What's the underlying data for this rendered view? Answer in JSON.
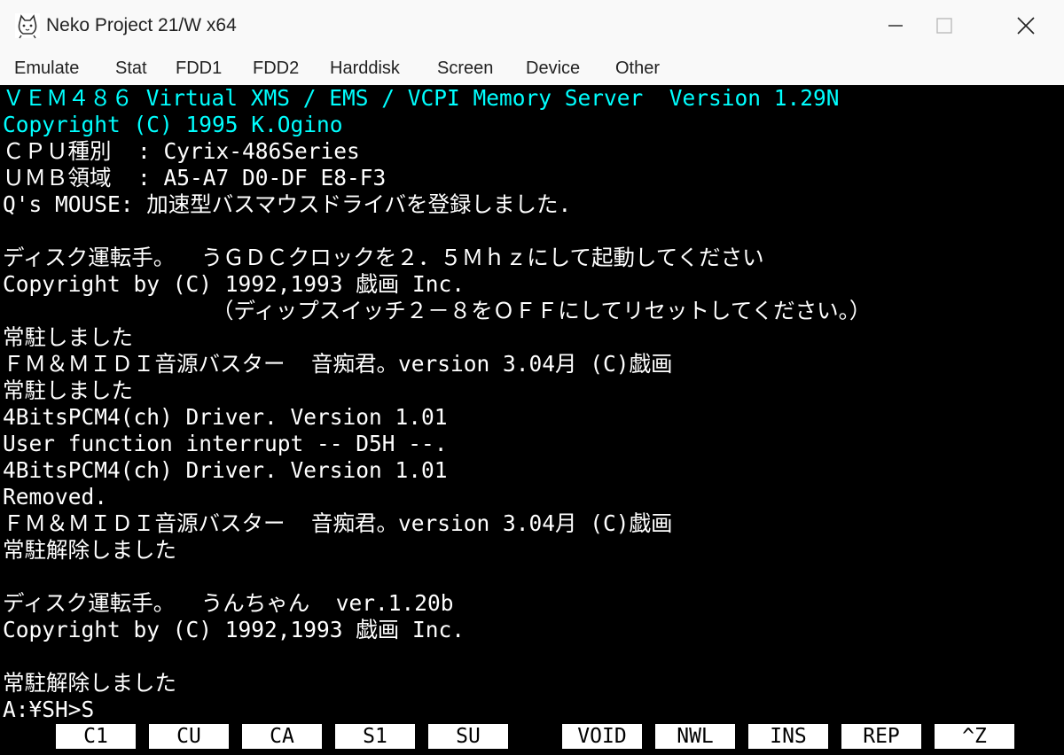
{
  "window": {
    "title": "Neko Project 21/W x64",
    "app_icon": "cat-icon",
    "minimize_icon": "minimize-icon",
    "maximize_icon": "maximize-icon",
    "close_icon": "close-icon"
  },
  "menu": [
    "Emulate",
    "Stat",
    "FDD1",
    "FDD2",
    "Harddisk",
    "Screen",
    "Device",
    "Other"
  ],
  "colors": {
    "cyan": "#00ffff",
    "white": "#ffffff",
    "background": "#000000",
    "fkey_bg": "#ffffff"
  },
  "screen_lines": [
    {
      "text": "ＶＥＭ４８６ Virtual XMS / EMS / VCPI Memory Server  Version 1.29N",
      "color": "cyan"
    },
    {
      "text": "Copyright (C) 1995 K.Ogino",
      "color": "cyan"
    },
    {
      "text": "ＣＰＵ種別  : Cyrix-486Series",
      "color": "white"
    },
    {
      "text": "ＵＭＢ領域  : A5-A7 D0-DF E8-F3",
      "color": "white"
    },
    {
      "text": "Q's MOUSE: 加速型バスマウスドライバを登録しました.",
      "color": "white"
    },
    {
      "text": "",
      "color": "white"
    },
    {
      "text": "ディスク運転手。  うＧＤＣクロックを２．５Ｍｈｚにして起動してください",
      "color": "white"
    },
    {
      "text": "Copyright by (C) 1992,1993 戯画 Inc.",
      "color": "white"
    },
    {
      "text": "                （ディップスイッチ２－８をＯＦＦにしてリセットしてください。）",
      "color": "white"
    },
    {
      "text": "常駐しました",
      "color": "white"
    },
    {
      "text": "ＦＭ＆ＭＩＤＩ音源バスター  音痴君。version 3.04月 (C)戯画",
      "color": "white"
    },
    {
      "text": "常駐しました",
      "color": "white"
    },
    {
      "text": "4BitsPCM4(ch) Driver. Version 1.01",
      "color": "white"
    },
    {
      "text": "User function interrupt -- D5H --.",
      "color": "white"
    },
    {
      "text": "4BitsPCM4(ch) Driver. Version 1.01",
      "color": "white"
    },
    {
      "text": "Removed.",
      "color": "white"
    },
    {
      "text": "ＦＭ＆ＭＩＤＩ音源バスター  音痴君。version 3.04月 (C)戯画",
      "color": "white"
    },
    {
      "text": "常駐解除しました",
      "color": "white"
    },
    {
      "text": "",
      "color": "white"
    },
    {
      "text": "ディスク運転手。  うんちゃん  ver.1.20b",
      "color": "white"
    },
    {
      "text": "Copyright by (C) 1992,1993 戯画 Inc.",
      "color": "white"
    },
    {
      "text": "",
      "color": "white"
    },
    {
      "text": "常駐解除しました",
      "color": "white"
    },
    {
      "text": "A:¥SH>S",
      "color": "white"
    }
  ],
  "function_keys": [
    "C1",
    "CU",
    "CA",
    "S1",
    "SU",
    "VOID",
    "NWL",
    "INS",
    "REP",
    "^Z"
  ]
}
